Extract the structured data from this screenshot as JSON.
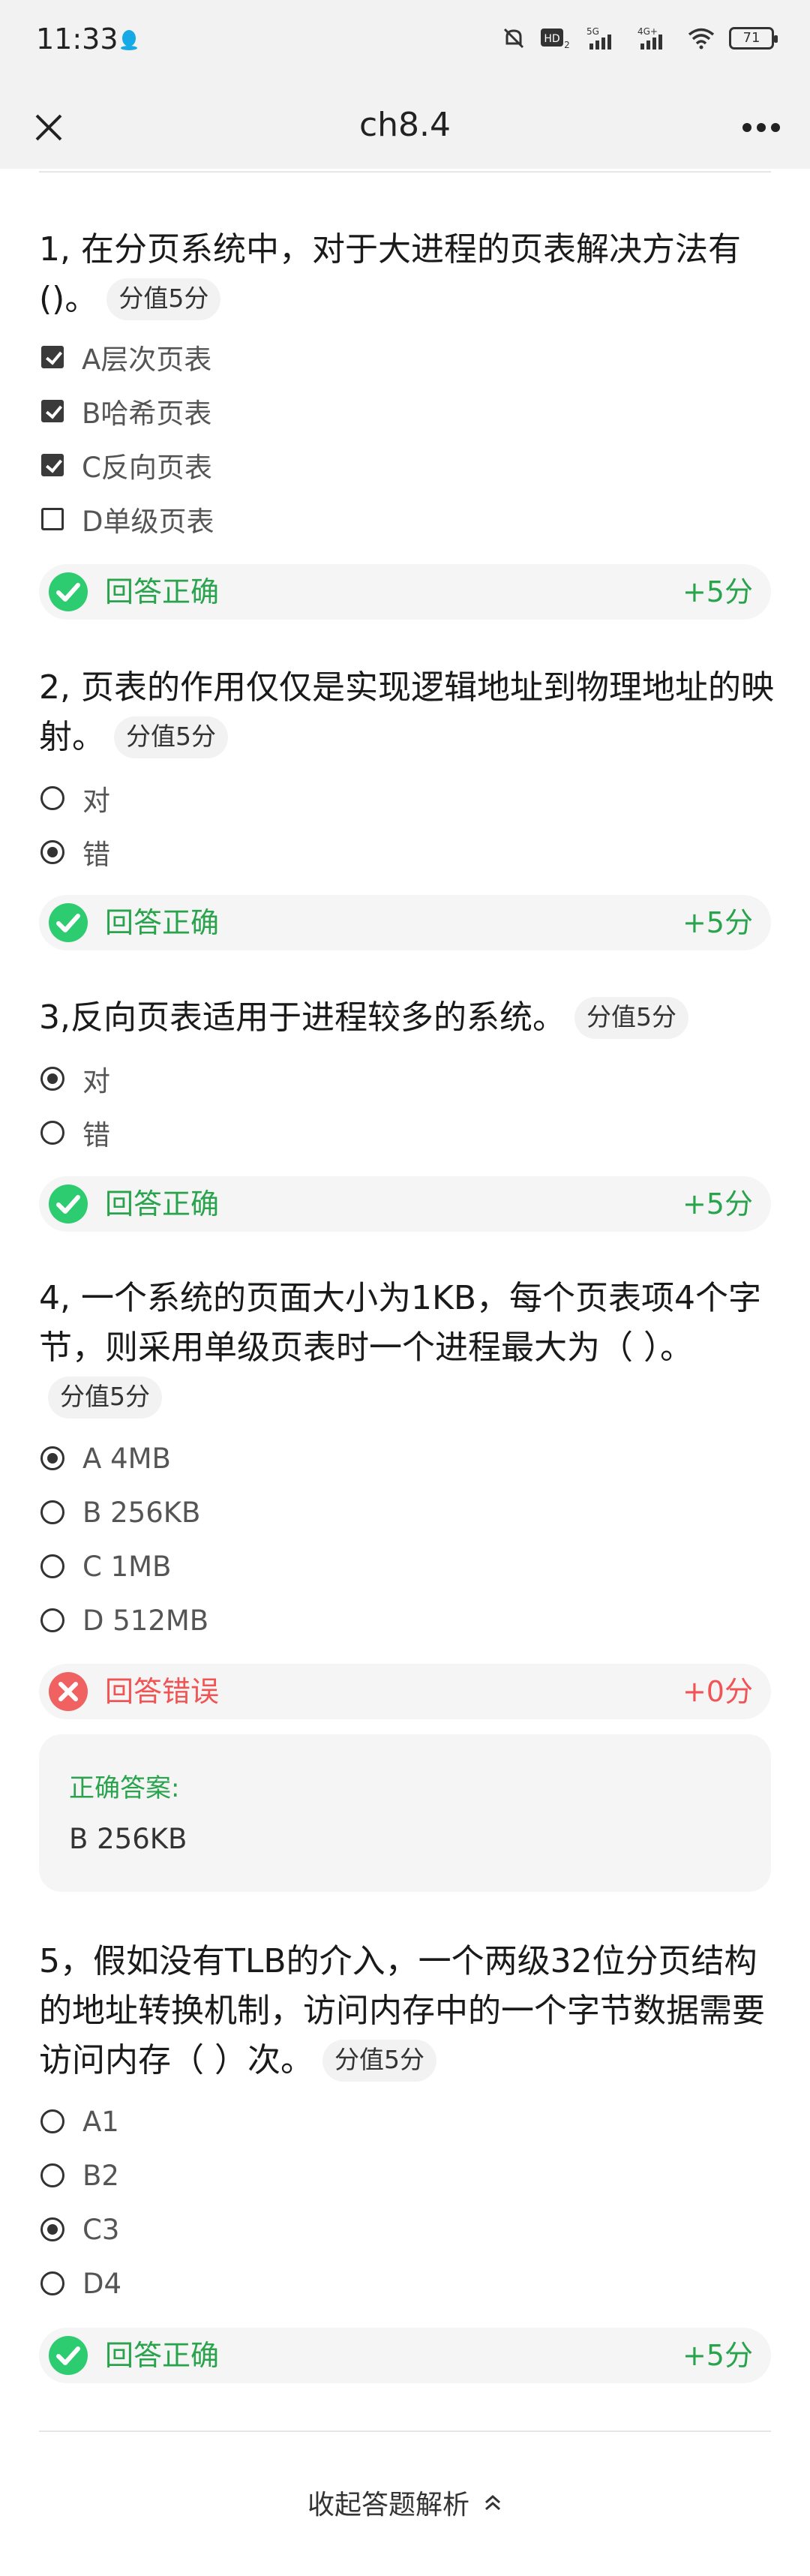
{
  "status_bar": {
    "time": "11:33",
    "battery": "71",
    "signal_5g": "5G",
    "signal_4g": "4G+",
    "hd": "HD"
  },
  "header": {
    "title": "ch8.4",
    "close_icon": "close-icon",
    "more_icon": "more-icon"
  },
  "colors": {
    "correct": "#2aa34d",
    "wrong": "#f05454"
  },
  "questions": [
    {
      "text": "1, 在分页系统中，对于大进程的页表解决方法有()。",
      "score_tag": "分值5分",
      "type": "multiple",
      "options": [
        {
          "label": "A层次页表",
          "checked": true
        },
        {
          "label": "B哈希页表",
          "checked": true
        },
        {
          "label": "C反向页表",
          "checked": true
        },
        {
          "label": "D单级页表",
          "checked": false
        }
      ],
      "result_label": "回答正确",
      "result_score": "+5分"
    },
    {
      "text": "2, 页表的作用仅仅是实现逻辑地址到物理地址的映射。",
      "score_tag": "分值5分",
      "type": "single",
      "options": [
        {
          "label": "对",
          "checked": false
        },
        {
          "label": "错",
          "checked": true
        }
      ],
      "result_label": "回答正确",
      "result_score": "+5分"
    },
    {
      "text": "3,反向页表适用于进程较多的系统。",
      "score_tag": "分值5分",
      "type": "single",
      "options": [
        {
          "label": "对",
          "checked": true
        },
        {
          "label": "错",
          "checked": false
        }
      ],
      "result_label": "回答正确",
      "result_score": "+5分"
    },
    {
      "text": "4, 一个系统的页面大小为1KB，每个页表项4个字节，则采用单级页表时一个进程最大为（ ）。",
      "score_tag": "分值5分",
      "type": "single",
      "options": [
        {
          "label": "A 4MB",
          "checked": true
        },
        {
          "label": "B 256KB",
          "checked": false
        },
        {
          "label": "C 1MB",
          "checked": false
        },
        {
          "label": "D 512MB",
          "checked": false
        }
      ],
      "result_label": "回答错误",
      "result_score": "+0分",
      "correct_answer_title": "正确答案:",
      "correct_answer": "B 256KB"
    },
    {
      "text": "5，假如没有TLB的介入，一个两级32位分页结构的地址转换机制，访问内存中的一个字节数据需要访问内存（ ）次。",
      "score_tag": "分值5分",
      "type": "single",
      "options": [
        {
          "label": "A1",
          "checked": false
        },
        {
          "label": "B2",
          "checked": false
        },
        {
          "label": "C3",
          "checked": true
        },
        {
          "label": "D4",
          "checked": false
        }
      ],
      "result_label": "回答正确",
      "result_score": "+5分"
    }
  ],
  "footer": {
    "collapse_label": "收起答题解析"
  }
}
